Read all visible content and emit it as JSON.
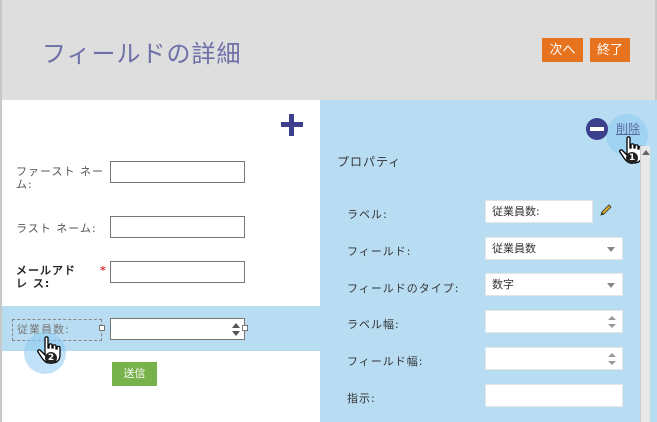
{
  "header": {
    "title": "フィールドの詳細",
    "next_label": "次へ",
    "finish_label": "終了"
  },
  "form": {
    "fields": [
      {
        "label": "ファースト ネー ム:",
        "value": ""
      },
      {
        "label": "ラスト ネーム:",
        "value": ""
      },
      {
        "label": "メールアドレ ス:",
        "required_mark": "*",
        "value": ""
      },
      {
        "label": "従業員数:",
        "value": ""
      }
    ],
    "submit_label": "送信"
  },
  "cursors": {
    "badge_1": "1",
    "badge_2": "2"
  },
  "properties": {
    "delete_label": "削除",
    "title": "プロパティ",
    "rows": [
      {
        "label": "ラベル:",
        "value": "従業員数:"
      },
      {
        "label": "フィールド:",
        "value": "従業員数"
      },
      {
        "label": "フィールドのタイプ:",
        "value": "数字"
      },
      {
        "label": "ラベル幅:",
        "value": ""
      },
      {
        "label": "フィールド幅:",
        "value": ""
      },
      {
        "label": "指示:",
        "value": ""
      }
    ]
  },
  "colors": {
    "accent_orange": "#e8731f",
    "submit_green": "#77b24a",
    "panel_blue": "#b8ddf3",
    "icon_navy": "#3b3f8c"
  }
}
